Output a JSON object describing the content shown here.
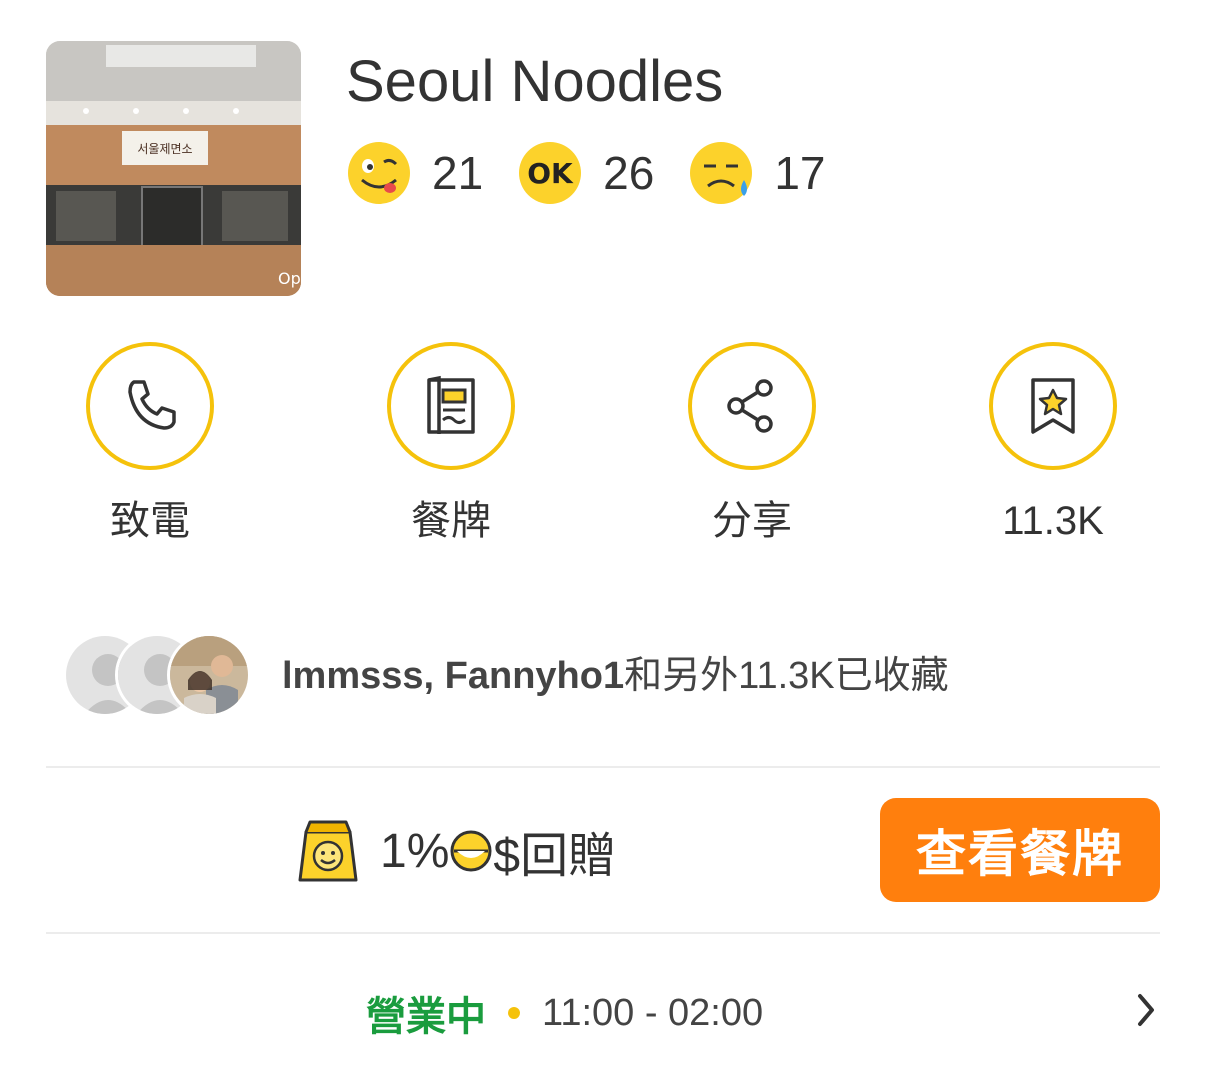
{
  "restaurant": {
    "name": "Seoul Noodles",
    "photo_sign_text": "서울제면소",
    "photo_watermark": "Oper"
  },
  "ratings": [
    {
      "icon": "smile-face-icon",
      "count": "21"
    },
    {
      "icon": "ok-face-icon",
      "count": "26"
    },
    {
      "icon": "sad-face-icon",
      "count": "17"
    }
  ],
  "actions": {
    "call_label": "致電",
    "menu_label": "餐牌",
    "share_label": "分享",
    "bookmark_count": "11.3K"
  },
  "bookmarks": {
    "users": "lmmsss, Fannyho1",
    "suffix": "和另外11.3K已收藏"
  },
  "cashback": {
    "percent": "1%",
    "currency_suffix": "$回贈",
    "button_label": "查看餐牌"
  },
  "hours": {
    "status": "營業中",
    "time_range": "11:00 - 02:00"
  },
  "colors": {
    "accent_yellow": "#f5c20b",
    "button_orange": "#ff7f0d",
    "open_green": "#1a9c3e"
  }
}
